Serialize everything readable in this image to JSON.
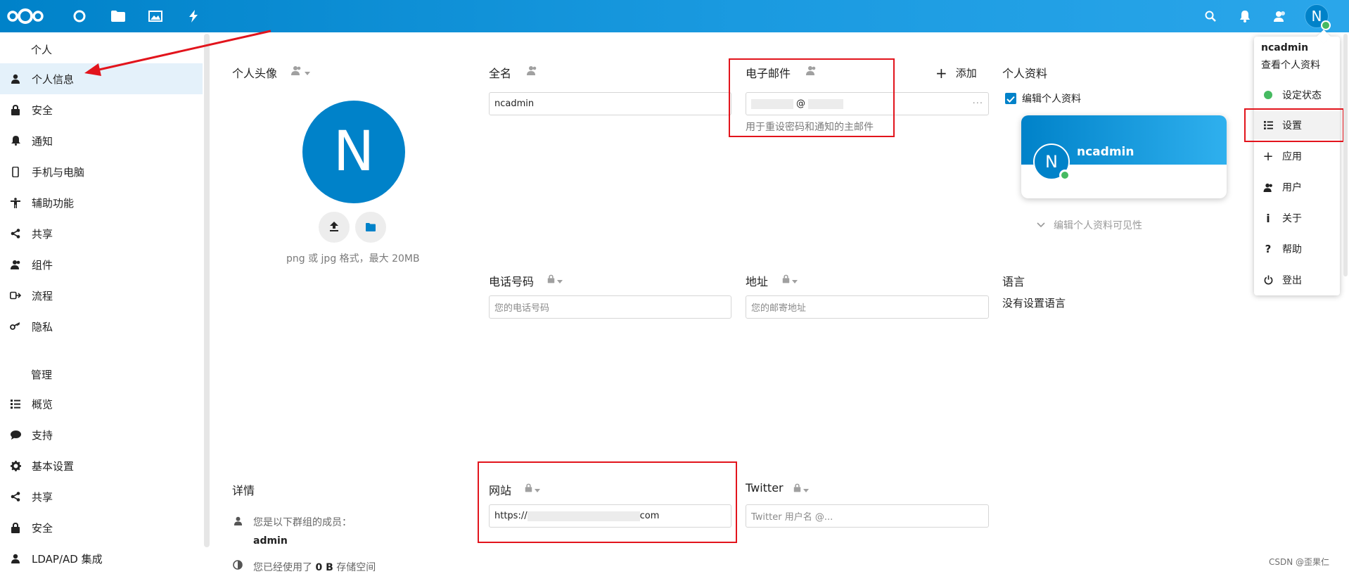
{
  "header": {
    "icons": [
      "nextcloud-logo-icon",
      "dashboard-icon",
      "files-icon",
      "photos-icon",
      "activity-icon",
      "search-icon",
      "notifications-icon",
      "contacts-icon"
    ],
    "avatar_initial": "N",
    "accent": "#0082c9"
  },
  "sidebar": {
    "section_personal": "个人",
    "personal_items": [
      {
        "label": "个人信息",
        "icon": "user-icon",
        "active": true
      },
      {
        "label": "安全",
        "icon": "lock-icon"
      },
      {
        "label": "通知",
        "icon": "bell-icon"
      },
      {
        "label": "手机与电脑",
        "icon": "phone-icon"
      },
      {
        "label": "辅助功能",
        "icon": "accessibility-icon"
      },
      {
        "label": "共享",
        "icon": "share-icon"
      },
      {
        "label": "组件",
        "icon": "group-icon"
      },
      {
        "label": "流程",
        "icon": "flow-icon"
      },
      {
        "label": "隐私",
        "icon": "key-icon"
      }
    ],
    "section_admin": "管理",
    "admin_items": [
      {
        "label": "概览",
        "icon": "list-icon"
      },
      {
        "label": "支持",
        "icon": "chat-icon"
      },
      {
        "label": "基本设置",
        "icon": "gear-icon"
      },
      {
        "label": "共享",
        "icon": "share-icon"
      },
      {
        "label": "安全",
        "icon": "lock-icon"
      },
      {
        "label": "LDAP/AD 集成",
        "icon": "user-icon"
      }
    ]
  },
  "main": {
    "avatar": {
      "label": "个人头像",
      "initial": "N",
      "hint": "png 或 jpg 格式，最大 20MB"
    },
    "fullname": {
      "label": "全名",
      "value": "ncadmin"
    },
    "email": {
      "label": "电子邮件",
      "value": "@",
      "hint": "用于重设密码和通知的主邮件",
      "add_label": "添加",
      "more": "···"
    },
    "profile": {
      "label": "个人资料",
      "enable_label": "编辑个人资料",
      "card_name": "ncadmin",
      "card_initial": "N",
      "visibility_label": "编辑个人资料可见性"
    },
    "phone": {
      "label": "电话号码",
      "placeholder": "您的电话号码"
    },
    "address": {
      "label": "地址",
      "placeholder": "您的邮寄地址"
    },
    "language": {
      "label": "语言",
      "value": "没有设置语言"
    },
    "details": {
      "label": "详情",
      "groups_text": "您是以下群组的成员：",
      "group_name": "admin",
      "storage_prefix": "您已经使用了",
      "storage_amount": "0 B",
      "storage_suffix": "存储空间"
    },
    "website": {
      "label": "网站",
      "value_prefix": "https://",
      "value_suffix": "com"
    },
    "twitter": {
      "label": "Twitter",
      "placeholder": "Twitter 用户名 @..."
    }
  },
  "user_menu": {
    "username": "ncadmin",
    "view_profile": "查看个人资料",
    "items": [
      {
        "label": "设定状态",
        "icon": "status-dot-icon"
      },
      {
        "label": "设置",
        "icon": "settings-list-icon",
        "active": true
      },
      {
        "label": "应用",
        "icon": "plus-icon"
      },
      {
        "label": "用户",
        "icon": "users-icon"
      },
      {
        "label": "关于",
        "icon": "info-icon"
      },
      {
        "label": "帮助",
        "icon": "help-icon"
      },
      {
        "label": "登出",
        "icon": "power-icon"
      }
    ]
  },
  "watermark": "CSDN @歪果仁",
  "colors": {
    "annotation_red": "#e2141c",
    "status_green": "#46ba61"
  }
}
